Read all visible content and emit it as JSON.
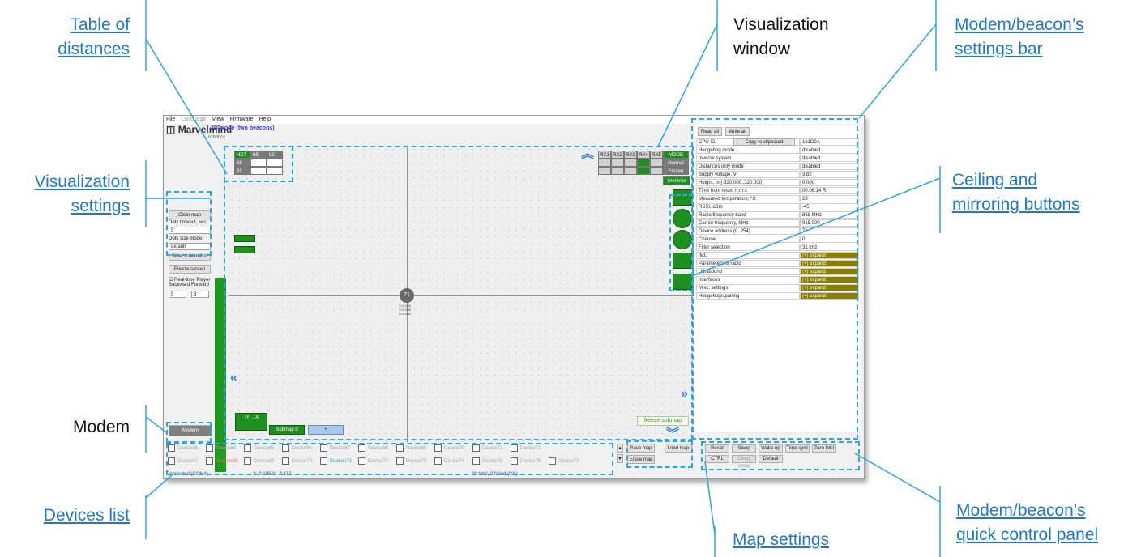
{
  "callouts": {
    "table_of_distances_1": "Table of",
    "table_of_distances_2": "distances",
    "visualization_window_1": "Visualization",
    "visualization_window_2": "window",
    "settings_bar_1": "Modem/beacon’s",
    "settings_bar_2": "settings bar",
    "visualization_settings_1": "Visualization",
    "visualization_settings_2": "settings",
    "ceiling_mirroring_1": "Ceiling and",
    "ceiling_mirroring_2": "mirroring buttons",
    "modem": "Modem",
    "devices_list": "Devices list",
    "map_settings": "Map settings",
    "quick_control_1": "Modem/beacon’s",
    "quick_control_2": "quick control panel"
  },
  "colors": {
    "callout_link": "#1f78c8",
    "dashed_frame": "#2aa8e0",
    "leader_line": "#2aa8e0",
    "green_buttons": "#1f8f1f",
    "expand_cells": "#8a7d00"
  },
  "app": {
    "menu": {
      "file": "File",
      "language": "Language",
      "view": "View",
      "firmware": "Firmware",
      "help": "Help"
    },
    "logo": "Marvelmind",
    "logo_sub": "robotics",
    "mode_title": "2D mode (two beacons)",
    "left_panel": {
      "clear_map": "Clear map",
      "dots_timeout_label": "Dots timeout, sec",
      "dots_timeout_value": "5",
      "dots_size_label": "Dots size mode",
      "dots_size_value": "default",
      "save_screenshot": "Save screenshot",
      "freeze_screen": "Freeze screen",
      "realtime_player": "Real-time Player",
      "backward": "Backward",
      "forward": "Forward",
      "backward_value": "5",
      "forward_value": "3",
      "modem_button": "Modem"
    },
    "distance_table": {
      "header": [
        "HDT",
        "68",
        "92"
      ],
      "rows": [
        [
          "68",
          "",
          ""
        ],
        [
          "92",
          "",
          ""
        ]
      ]
    },
    "rx_table": {
      "header": [
        "RX1",
        "RX2",
        "RX3",
        "RX4",
        "RX5",
        "MODE"
      ],
      "modes": [
        "Normal",
        "Frozen",
        "Unmirror"
      ]
    },
    "beacon": {
      "id": "71",
      "coords": [
        "X=0.000",
        "Y=0.000",
        "Z=0.000"
      ]
    },
    "map_buttons": {
      "submap": "Submap 0",
      "plus": "+",
      "freeze_submap": "freeze submap"
    },
    "settings_bar": {
      "read_all": "Read all",
      "write_all": "Write all",
      "copy_clipboard": "Copy to clipboard",
      "rows": [
        {
          "k": "CPU ID",
          "v": "161D2A"
        },
        {
          "k": "Hedgehog mode",
          "v": "disabled"
        },
        {
          "k": "Inverse system",
          "v": "disabled"
        },
        {
          "k": "Distances only mode",
          "v": "disabled"
        },
        {
          "k": "Supply voltage, V",
          "v": "3.82"
        },
        {
          "k": "Height, m (-320.000..320.000)",
          "v": "0.000"
        },
        {
          "k": "Time from reset, h:m:s",
          "v": "00:06:14  R"
        },
        {
          "k": "Measured temperature, °C",
          "v": "23"
        },
        {
          "k": "RSSI, dBm",
          "v": "-45"
        },
        {
          "k": "Radio frequency band",
          "v": "868 MHz"
        },
        {
          "k": "Carrier frequency, MHz",
          "v": "915.000"
        },
        {
          "k": "Device address (0..254)",
          "v": "71"
        },
        {
          "k": "Channel",
          "v": "0"
        },
        {
          "k": "Filter selection",
          "v": "31 kHz"
        },
        {
          "k": "IMU",
          "v": "(+) expand"
        },
        {
          "k": "Parameters of radio",
          "v": "(+) expand"
        },
        {
          "k": "Ultrasound",
          "v": "(+) expand"
        },
        {
          "k": "Interfaces",
          "v": "(+) expand"
        },
        {
          "k": "Misc. settings",
          "v": "(+) expand"
        },
        {
          "k": "Hedgehogs pairing",
          "v": "(+) expand"
        }
      ]
    },
    "quick_panel": {
      "reset": "Reset",
      "sleep": "Sleep",
      "wake_up": "Wake up",
      "time_sync": "Time sync",
      "zero_imu": "Zero IMU",
      "ctrl": "CTRL",
      "deep_sleep": "Deep sleep",
      "default": "Default"
    },
    "map_settings": {
      "save_map": "Save map",
      "load_map": "Load map",
      "erase_map": "Erase map"
    },
    "devices_row1": [
      "Device06",
      "Device64",
      "Device65",
      "Device66",
      "Device67",
      "Device68",
      "Device69",
      "Device70",
      "Device71",
      "Device72"
    ],
    "devices_row2": [
      "Device67",
      "Beacon68",
      "Device69",
      "Device70",
      "Beacon71",
      "Device72",
      "Device73",
      "Device74",
      "Device75",
      "Device76",
      "Device77"
    ],
    "status": {
      "left": "Connected (COM4)",
      "mid": "X: 0.195  Y: -0.151",
      "right": "29 total, 0 failed (0%)"
    }
  }
}
